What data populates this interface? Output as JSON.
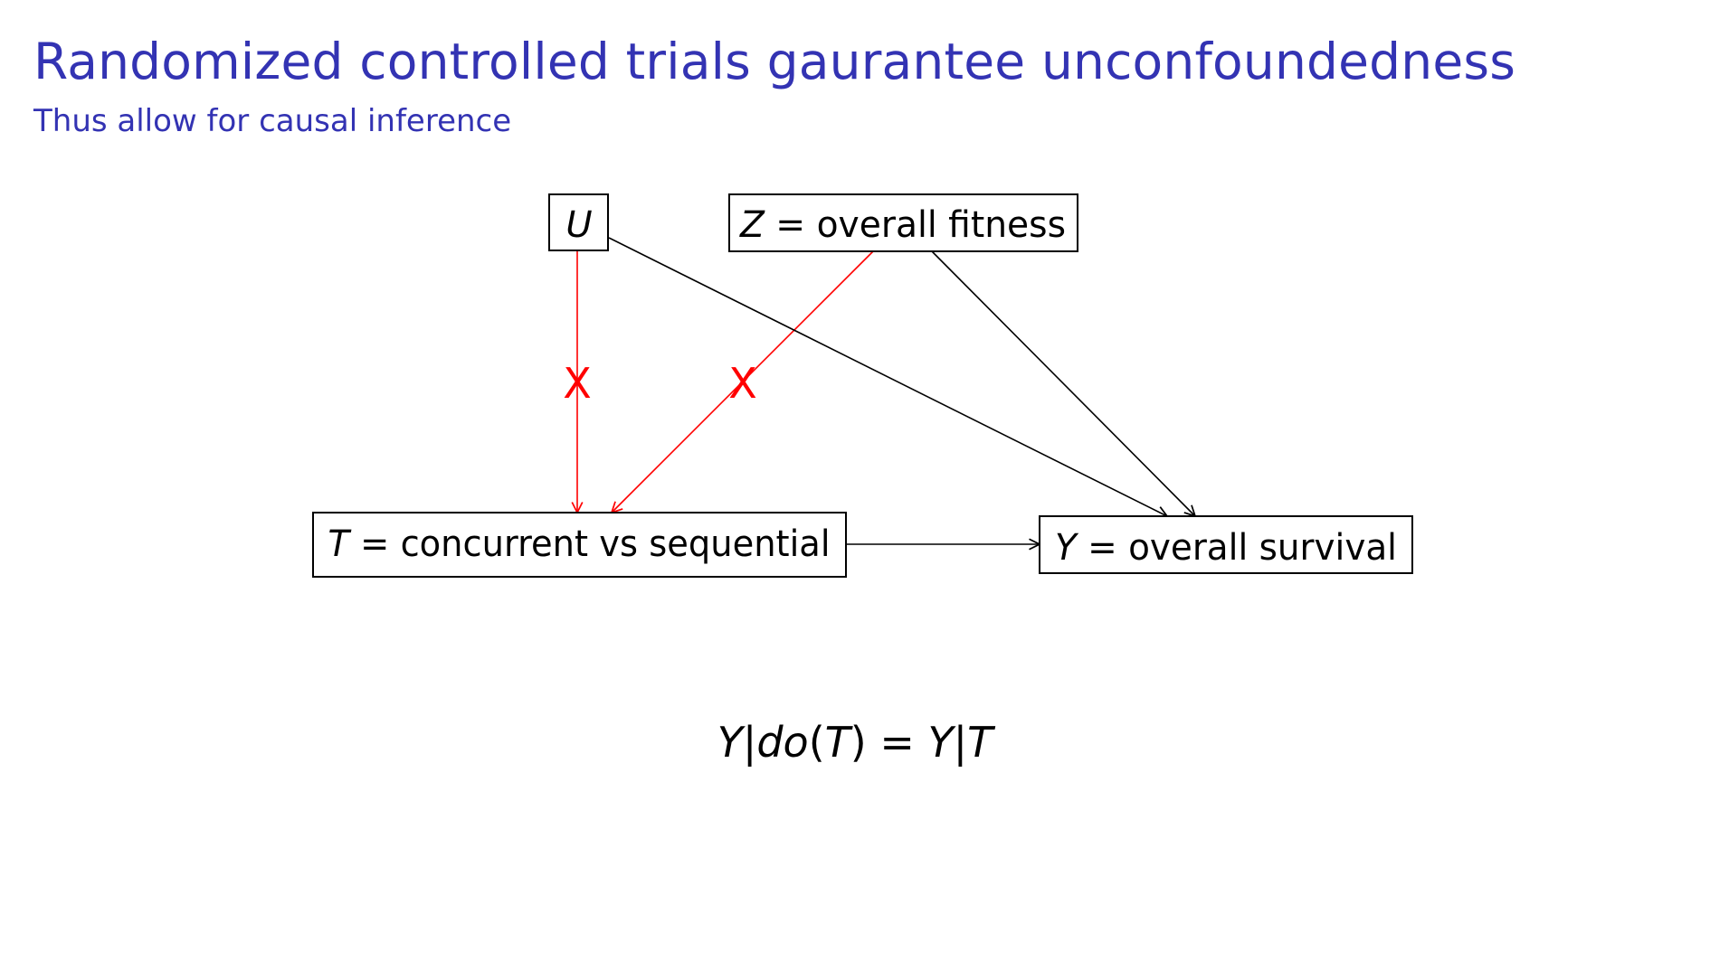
{
  "title": "Randomized controlled trials gaurantee unconfoundedness",
  "subtitle": "Thus allow for causal inference",
  "colors": {
    "title": "#3333b3",
    "blocked_edge": "#ff0000",
    "edge": "#000000"
  },
  "nodes": {
    "U": {
      "var": "U",
      "label": ""
    },
    "Z": {
      "var": "Z",
      "eq": " = ",
      "label": "overall fitness"
    },
    "T": {
      "var": "T",
      "eq": " = ",
      "label": "concurrent vs sequential"
    },
    "Y": {
      "var": "Y",
      "eq": " = ",
      "label": "overall survival"
    }
  },
  "edges": [
    {
      "from": "U",
      "to": "T",
      "blocked": true,
      "mark": "X"
    },
    {
      "from": "Z",
      "to": "T",
      "blocked": true,
      "mark": "X"
    },
    {
      "from": "U",
      "to": "Y",
      "blocked": false
    },
    {
      "from": "Z",
      "to": "Y",
      "blocked": false
    },
    {
      "from": "T",
      "to": "Y",
      "blocked": false
    }
  ],
  "formula": {
    "lhs_var": "Y",
    "bar1": "|",
    "do": "do",
    "open": "(",
    "arg": "T",
    "close": ")",
    "eq": " = ",
    "rhs_var": "Y",
    "bar2": "|",
    "rhs_arg": "T"
  }
}
